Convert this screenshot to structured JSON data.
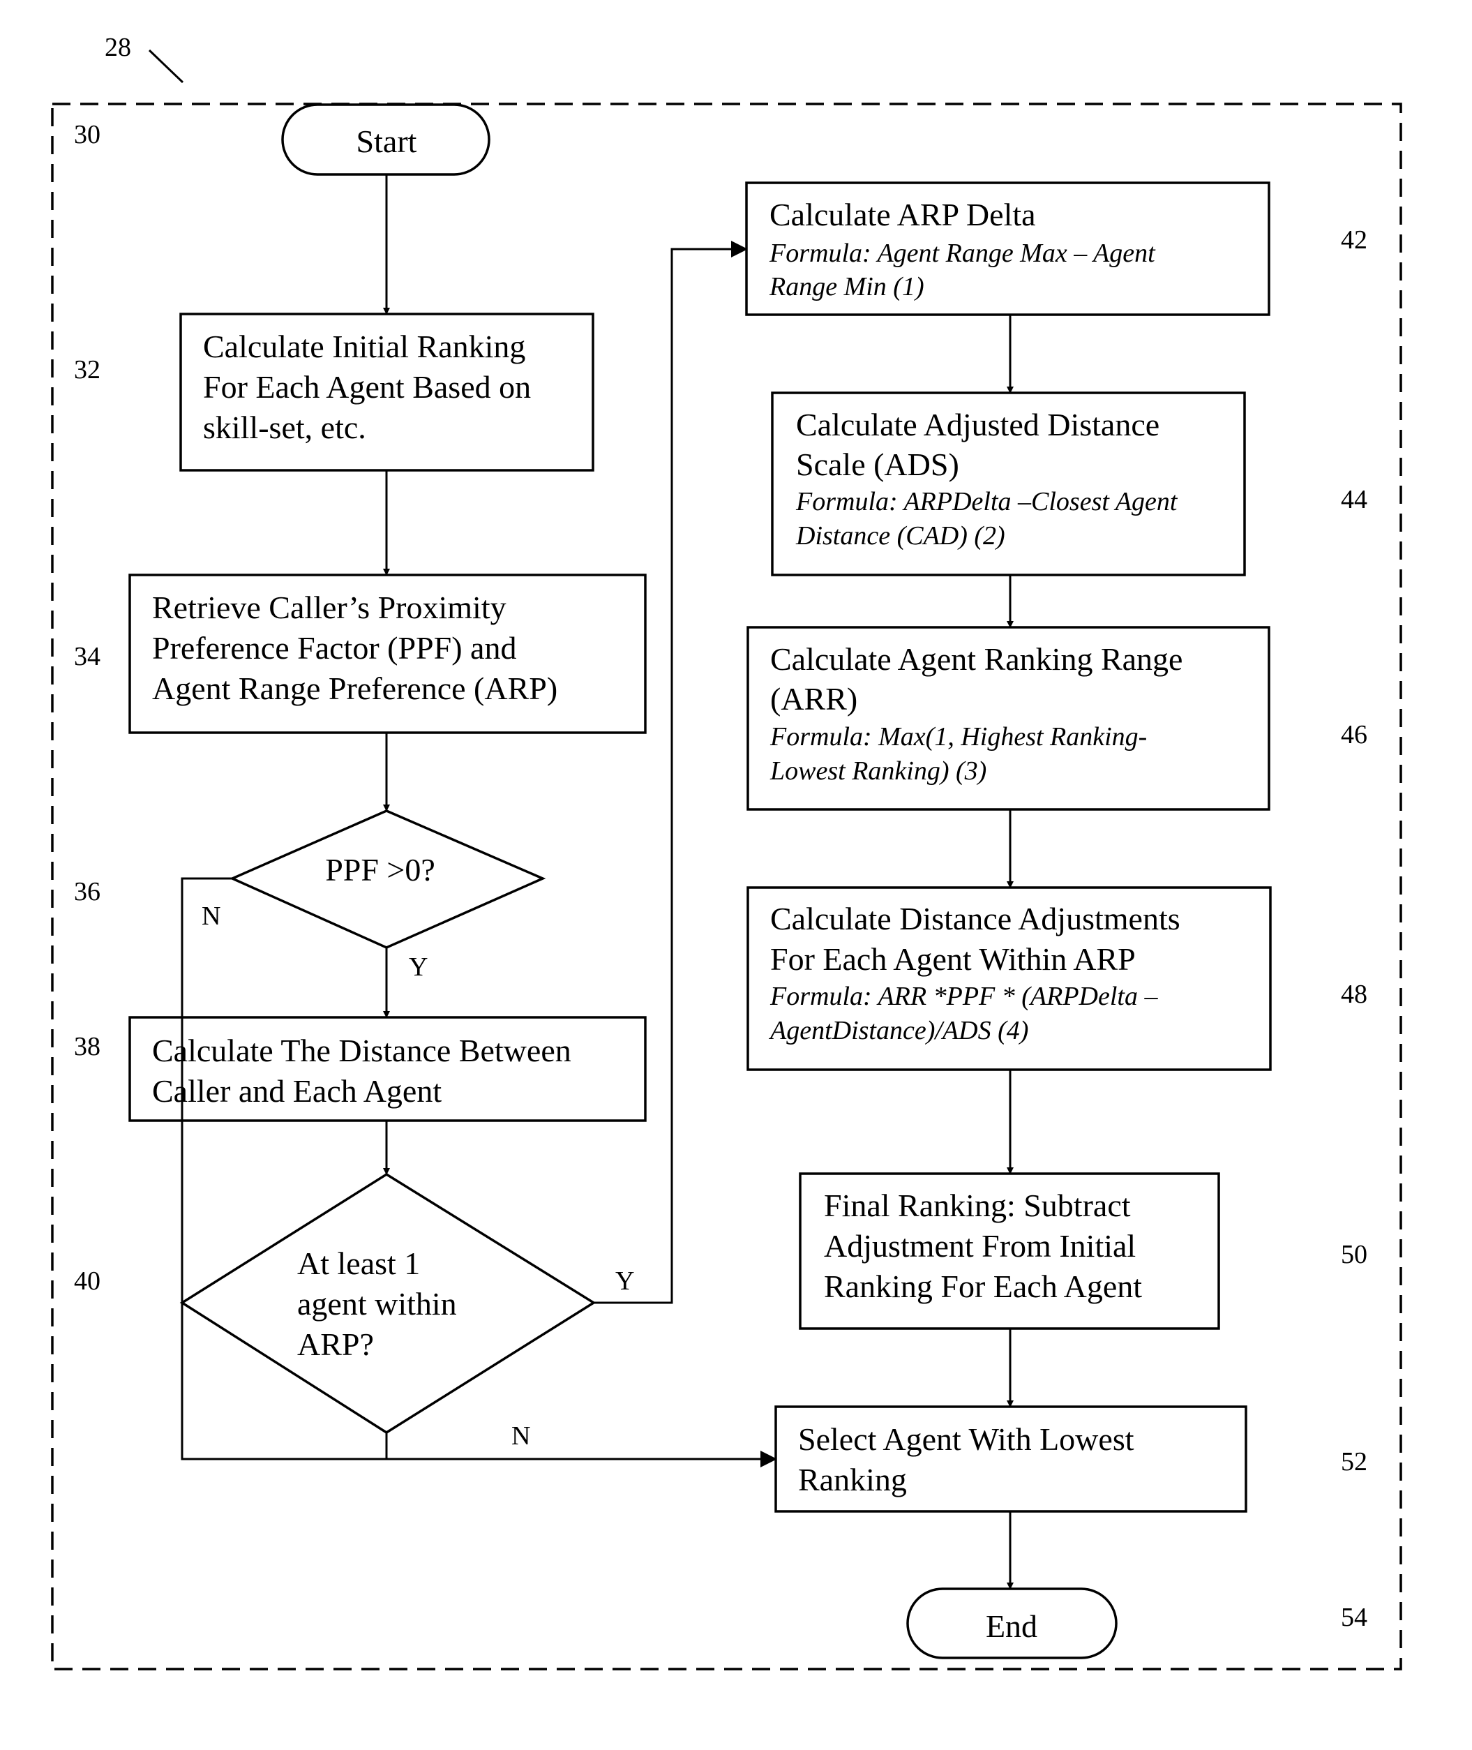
{
  "figure": {
    "ref_label": "28",
    "ref_numbers": {
      "start": "30",
      "initial_ranking": "32",
      "retrieve_ppf_arp": "34",
      "ppf_decision": "36",
      "calc_distance": "38",
      "agent_within_decision": "40",
      "arp_delta": "42",
      "ads": "44",
      "arr": "46",
      "distance_adjustments": "48",
      "final_ranking": "50",
      "select_agent": "52",
      "end": "54"
    }
  },
  "nodes": {
    "start": {
      "label": "Start"
    },
    "initial_ranking": {
      "lines": [
        "Calculate Initial Ranking",
        "For Each Agent Based on",
        "skill-set, etc."
      ]
    },
    "retrieve_ppf_arp": {
      "lines": [
        "Retrieve Caller’s Proximity",
        "Preference Factor (PPF)  and",
        "Agent Range Preference (ARP)"
      ]
    },
    "ppf_decision": {
      "lines": [
        "PPF >0?"
      ]
    },
    "calc_distance": {
      "lines": [
        "Calculate The Distance Between",
        "Caller and Each Agent"
      ]
    },
    "agent_within_decision": {
      "lines": [
        "At least 1",
        "agent within",
        "ARP?"
      ]
    },
    "arp_delta": {
      "lines": [
        "Calculate ARP Delta"
      ],
      "formula": [
        "Formula: Agent Range Max – Agent",
        "Range Min (1)"
      ]
    },
    "ads": {
      "lines": [
        "Calculate Adjusted Distance",
        "Scale (ADS)"
      ],
      "formula": [
        "Formula: ARPDelta –Closest Agent",
        "Distance (CAD)  (2)"
      ]
    },
    "arr": {
      "lines": [
        "Calculate Agent Ranking Range",
        "(ARR)"
      ],
      "formula": [
        "Formula: Max(1,  Highest Ranking-",
        "Lowest Ranking) (3)"
      ]
    },
    "distance_adjustments": {
      "lines": [
        "Calculate Distance Adjustments",
        "For Each Agent Within ARP"
      ],
      "formula": [
        "Formula: ARR *PPF * (ARPDelta –",
        "AgentDistance)/ADS (4)"
      ]
    },
    "final_ranking": {
      "lines": [
        "Final Ranking:  Subtract",
        "Adjustment From Initial",
        "Ranking For Each Agent"
      ]
    },
    "select_agent": {
      "lines": [
        "Select Agent With Lowest",
        "Ranking"
      ]
    },
    "end": {
      "label": "End"
    }
  },
  "edge_labels": {
    "ppf_no": "N",
    "ppf_yes": "Y",
    "within_yes": "Y",
    "within_no": "N"
  }
}
